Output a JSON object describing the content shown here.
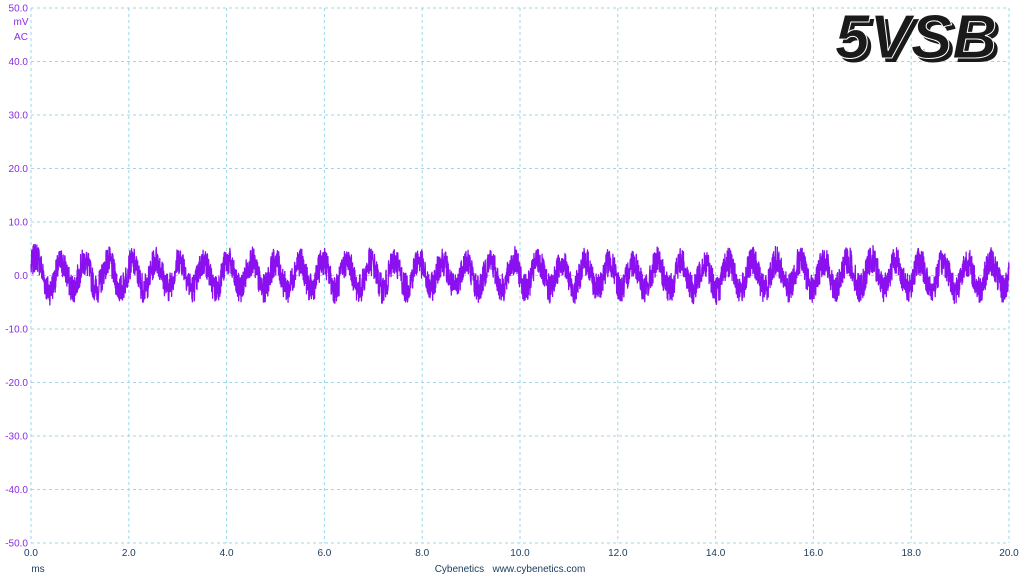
{
  "chart_data": {
    "type": "line",
    "title": "5VSB",
    "xlabel": "ms",
    "ylabel_unit": "mV",
    "ylabel_coupling": "AC",
    "xlim": [
      0,
      20
    ],
    "ylim": [
      -50,
      50
    ],
    "x_ticks": [
      "0.0",
      "2.0",
      "4.0",
      "6.0",
      "8.0",
      "10.0",
      "12.0",
      "14.0",
      "16.0",
      "18.0",
      "20.0"
    ],
    "y_ticks": [
      "50.0",
      "40.0",
      "30.0",
      "20.0",
      "10.0",
      "0.0",
      "-10.0",
      "-20.0",
      "-30.0",
      "-40.0",
      "-50.0"
    ],
    "grid": true,
    "footer": "Cybenetics   www.cybenetics.com",
    "series": [
      {
        "color": "#8a10f0",
        "ripple_cycles": 41,
        "envelope_mV": [
          -5.5,
          7.2
        ],
        "x": [
          0,
          0.25,
          0.5,
          0.75,
          1,
          1.5,
          2,
          2.5,
          3,
          3.5,
          4,
          5,
          6,
          7,
          8,
          9,
          10,
          11,
          12,
          13,
          14,
          15,
          16,
          17,
          17.5,
          18,
          19,
          20
        ],
        "y": [
          5.5,
          0.5,
          -2,
          1,
          0,
          0.5,
          -0.5,
          1,
          1.5,
          0,
          0.5,
          0,
          0.5,
          0,
          1,
          0.5,
          0.5,
          0,
          0,
          0,
          -0.5,
          0.5,
          0.5,
          1,
          1.5,
          0.5,
          0,
          0.5
        ]
      }
    ]
  }
}
